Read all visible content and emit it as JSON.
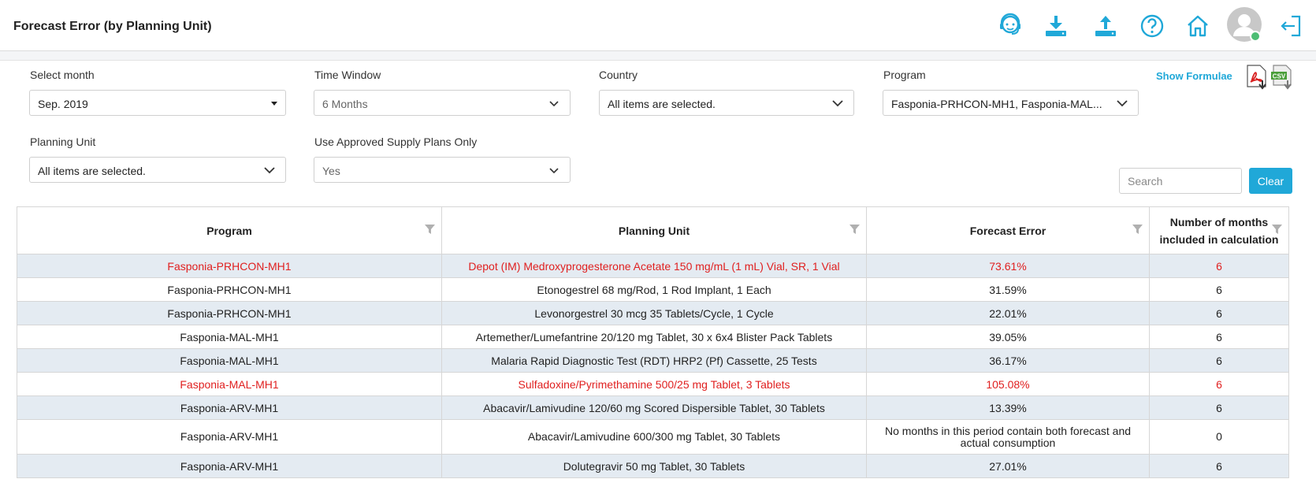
{
  "header": {
    "title": "Forecast Error (by Planning Unit)",
    "icons": [
      "support-agent-icon",
      "download-icon",
      "upload-icon",
      "help-icon",
      "home-icon",
      "user-avatar",
      "logout-icon"
    ]
  },
  "filters": {
    "month": {
      "label": "Select month",
      "value": "Sep. 2019"
    },
    "time_window": {
      "label": "Time Window",
      "value": "6 Months"
    },
    "country": {
      "label": "Country",
      "value": "All items are selected."
    },
    "program": {
      "label": "Program",
      "value": "Fasponia-PRHCON-MH1, Fasponia-MAL..."
    },
    "planning_unit": {
      "label": "Planning Unit",
      "value": "All items are selected."
    },
    "approved_only": {
      "label": "Use Approved Supply Plans Only",
      "value": "Yes"
    }
  },
  "toolbar": {
    "show_formulae": "Show Formulae",
    "export_icons": [
      "pdf-export-icon",
      "csv-export-icon"
    ],
    "csv_text": "CSV",
    "search_placeholder": "Search",
    "clear_label": "Clear"
  },
  "table": {
    "columns": [
      "Program",
      "Planning Unit",
      "Forecast Error",
      "Number of months included in calculation"
    ],
    "rows": [
      {
        "program": "Fasponia-PRHCON-MH1",
        "planning_unit": "Depot (IM) Medroxyprogesterone Acetate 150 mg/mL (1 mL) Vial, SR, 1 Vial",
        "forecast_error": "73.61%",
        "months": "6",
        "highlight": true
      },
      {
        "program": "Fasponia-PRHCON-MH1",
        "planning_unit": "Etonogestrel 68 mg/Rod, 1 Rod Implant, 1 Each",
        "forecast_error": "31.59%",
        "months": "6",
        "highlight": false
      },
      {
        "program": "Fasponia-PRHCON-MH1",
        "planning_unit": "Levonorgestrel 30 mcg 35 Tablets/Cycle, 1 Cycle",
        "forecast_error": "22.01%",
        "months": "6",
        "highlight": false
      },
      {
        "program": "Fasponia-MAL-MH1",
        "planning_unit": "Artemether/Lumefantrine 20/120 mg Tablet, 30 x 6x4 Blister Pack Tablets",
        "forecast_error": "39.05%",
        "months": "6",
        "highlight": false
      },
      {
        "program": "Fasponia-MAL-MH1",
        "planning_unit": "Malaria Rapid Diagnostic Test (RDT) HRP2 (Pf) Cassette, 25 Tests",
        "forecast_error": "36.17%",
        "months": "6",
        "highlight": false
      },
      {
        "program": "Fasponia-MAL-MH1",
        "planning_unit": "Sulfadoxine/Pyrimethamine 500/25 mg Tablet, 3 Tablets",
        "forecast_error": "105.08%",
        "months": "6",
        "highlight": true
      },
      {
        "program": "Fasponia-ARV-MH1",
        "planning_unit": "Abacavir/Lamivudine 120/60 mg Scored Dispersible Tablet, 30 Tablets",
        "forecast_error": "13.39%",
        "months": "6",
        "highlight": false
      },
      {
        "program": "Fasponia-ARV-MH1",
        "planning_unit": "Abacavir/Lamivudine 600/300 mg Tablet, 30 Tablets",
        "forecast_error": "No months in this period contain both forecast and actual consumption",
        "months": "0",
        "highlight": false
      },
      {
        "program": "Fasponia-ARV-MH1",
        "planning_unit": "Dolutegravir 50 mg Tablet, 30 Tablets",
        "forecast_error": "27.01%",
        "months": "6",
        "highlight": false
      }
    ]
  },
  "colors": {
    "accent": "#20a8d8",
    "highlight_text": "#e02020",
    "row_alt": "#e4ebf2",
    "status_online": "#4dbd74"
  }
}
